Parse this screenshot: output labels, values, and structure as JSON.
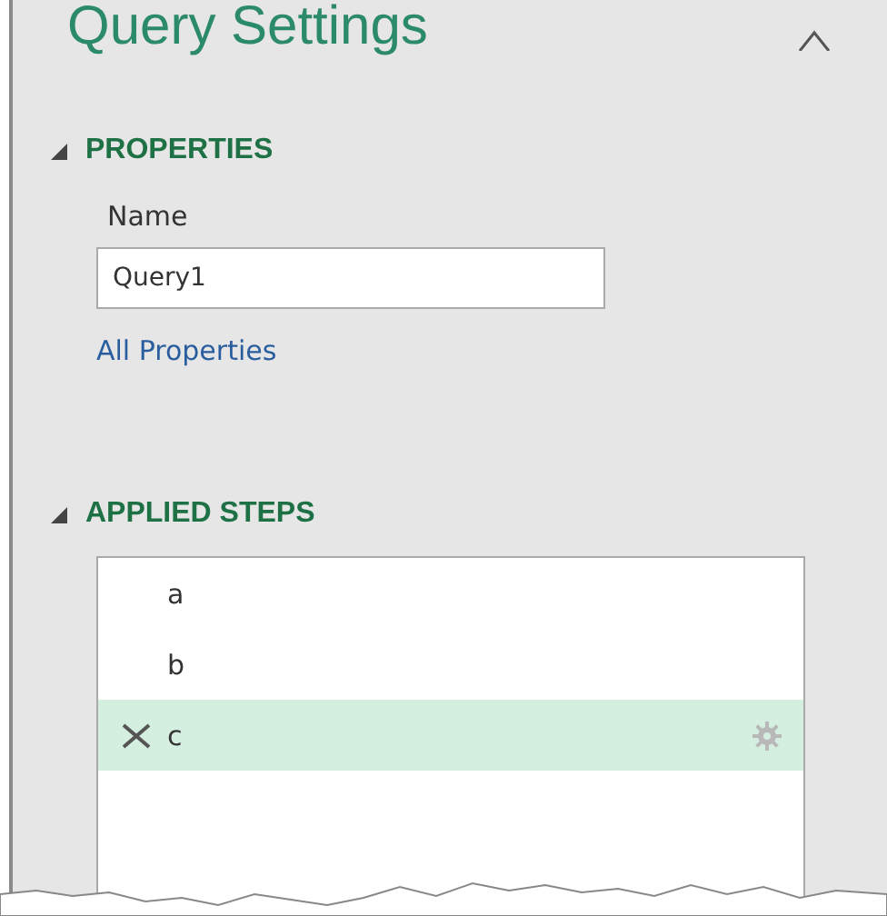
{
  "panel": {
    "title": "Query Settings"
  },
  "properties": {
    "heading": "PROPERTIES",
    "expanded": true,
    "name_label": "Name",
    "name_value": "Query1",
    "link": "All Properties"
  },
  "applied_steps": {
    "heading": "APPLIED STEPS",
    "expanded": true,
    "steps": [
      {
        "label": "a",
        "selected": false
      },
      {
        "label": "b",
        "selected": false
      },
      {
        "label": "c",
        "selected": true
      }
    ]
  }
}
